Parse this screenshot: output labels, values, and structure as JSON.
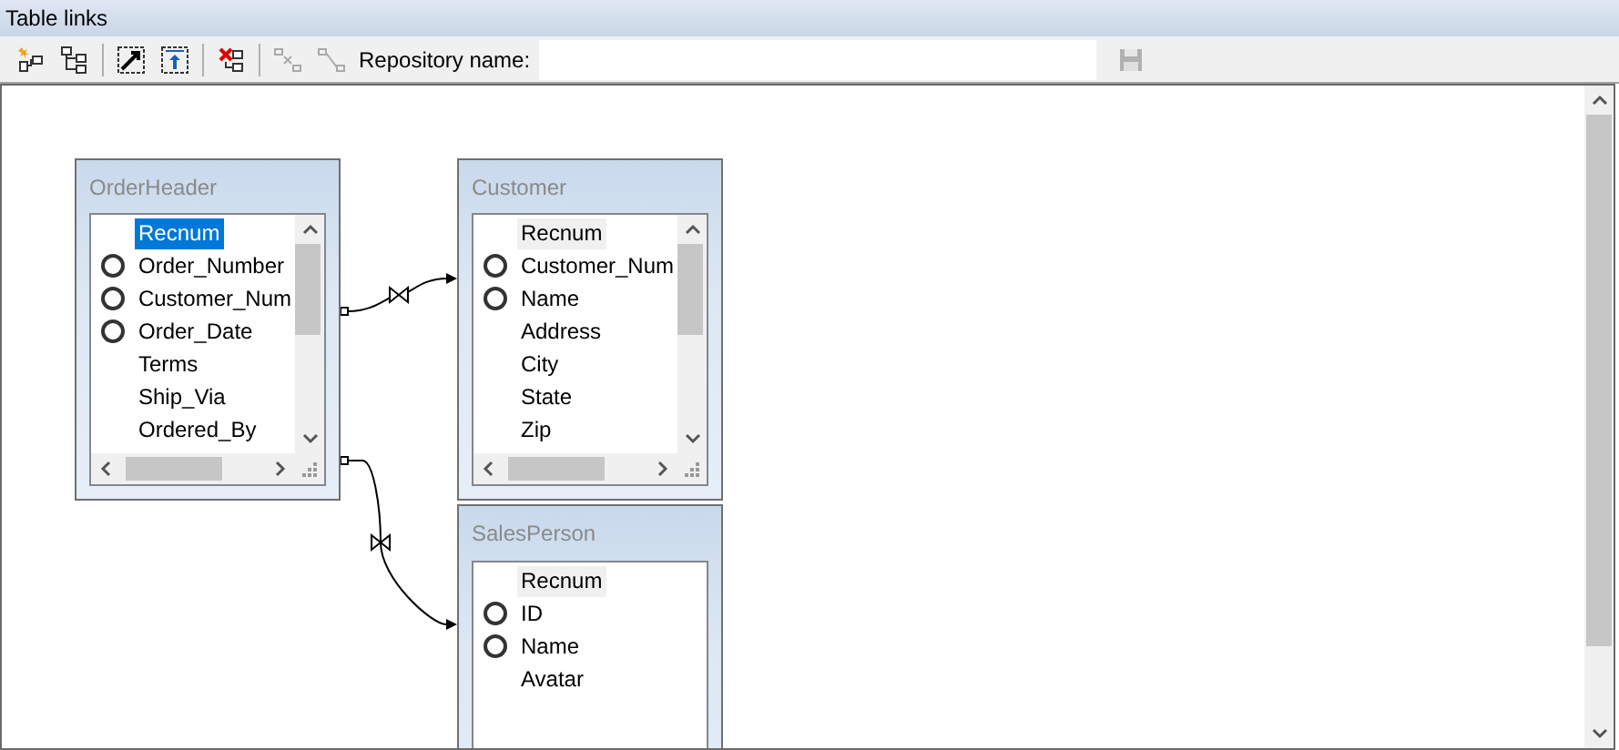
{
  "panel": {
    "title": "Table links"
  },
  "toolbar": {
    "buttons": [
      {
        "kind": "add",
        "disabled": false
      },
      {
        "kind": "tree",
        "disabled": false
      },
      {
        "kind": "resize",
        "disabled": false
      },
      {
        "kind": "upload",
        "disabled": false
      },
      {
        "kind": "remove",
        "disabled": false
      },
      {
        "kind": "unlink",
        "disabled": true
      },
      {
        "kind": "relink",
        "disabled": true
      }
    ],
    "repository_label": "Repository name:",
    "save_disabled": true
  },
  "tables": [
    {
      "name": "OrderHeader",
      "focused": true,
      "scrollable": true,
      "fields": [
        {
          "name": "Recnum",
          "key": false,
          "selected": true
        },
        {
          "name": "Order_Number",
          "key": true,
          "selected": false
        },
        {
          "name": "Customer_Num",
          "key": true,
          "selected": false
        },
        {
          "name": "Order_Date",
          "key": true,
          "selected": false
        },
        {
          "name": "Terms",
          "key": false,
          "selected": false
        },
        {
          "name": "Ship_Via",
          "key": false,
          "selected": false
        },
        {
          "name": "Ordered_By",
          "key": false,
          "selected": false
        }
      ]
    },
    {
      "name": "Customer",
      "focused": false,
      "scrollable": true,
      "fields": [
        {
          "name": "Recnum",
          "key": false,
          "selected": true
        },
        {
          "name": "Customer_Num",
          "key": true,
          "selected": false
        },
        {
          "name": "Name",
          "key": true,
          "selected": false
        },
        {
          "name": "Address",
          "key": false,
          "selected": false
        },
        {
          "name": "City",
          "key": false,
          "selected": false
        },
        {
          "name": "State",
          "key": false,
          "selected": false
        },
        {
          "name": "Zip",
          "key": false,
          "selected": false
        }
      ]
    },
    {
      "name": "SalesPerson",
      "focused": false,
      "scrollable": false,
      "fields": [
        {
          "name": "Recnum",
          "key": false,
          "selected": true
        },
        {
          "name": "ID",
          "key": true,
          "selected": false
        },
        {
          "name": "Name",
          "key": true,
          "selected": false
        },
        {
          "name": "Avatar",
          "key": false,
          "selected": false
        }
      ]
    }
  ]
}
